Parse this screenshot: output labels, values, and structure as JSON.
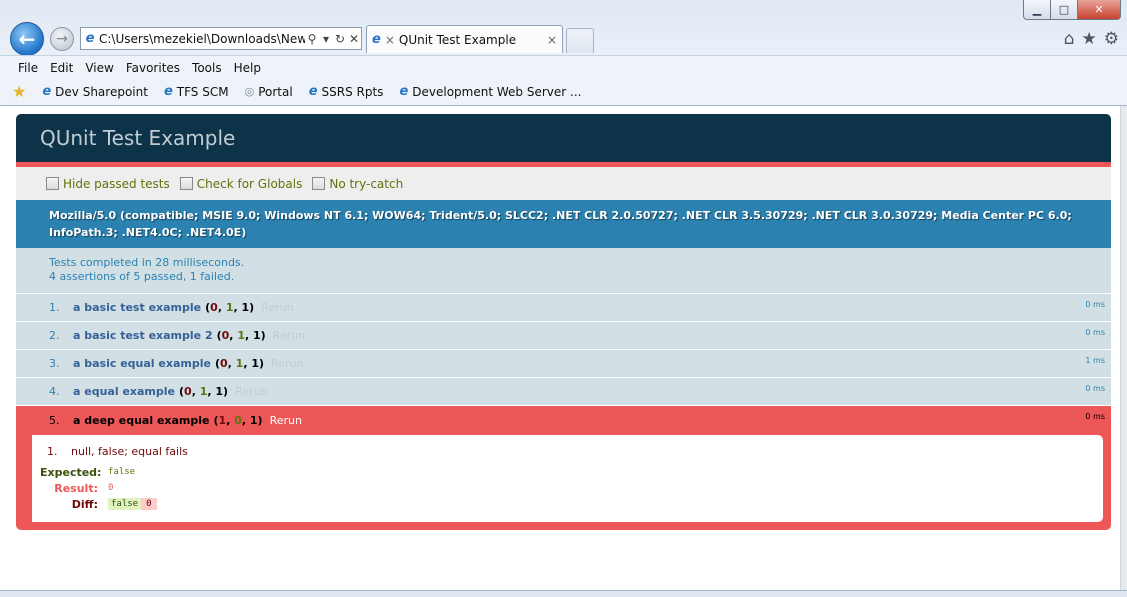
{
  "browser": {
    "address": "C:\\Users\\mezekiel\\Downloads\\New",
    "tab_title": "QUnit Test Example",
    "tab_close": "×",
    "menu": [
      "File",
      "Edit",
      "View",
      "Favorites",
      "Tools",
      "Help"
    ],
    "favorites": [
      "Dev Sharepoint",
      "TFS SCM",
      "Portal",
      "SSRS Rpts",
      "Development Web Server ..."
    ]
  },
  "qunit": {
    "title": "QUnit Test Example",
    "toolbar": {
      "hide_passed": "Hide passed tests",
      "check_globals": "Check for Globals",
      "no_try_catch": "No try-catch"
    },
    "user_agent": "Mozilla/5.0 (compatible; MSIE 9.0; Windows NT 6.1; WOW64; Trident/5.0; SLCC2; .NET CLR 2.0.50727; .NET CLR 3.5.30729; .NET CLR 3.0.30729; Media Center PC 6.0; InfoPath.3; .NET4.0C; .NET4.0E)",
    "result_line1": "Tests completed in 28 milliseconds.",
    "result_line2": "4 assertions of 5 passed, 1 failed.",
    "rerun_label": "Rerun",
    "tests": [
      {
        "num": "1.",
        "name": "a basic test example",
        "failed": "0",
        "passed": "1",
        "total": "1",
        "duration": "0 ms"
      },
      {
        "num": "2.",
        "name": "a basic test example 2",
        "failed": "0",
        "passed": "1",
        "total": "1",
        "duration": "0 ms"
      },
      {
        "num": "3.",
        "name": "a basic equal example",
        "failed": "0",
        "passed": "1",
        "total": "1",
        "duration": "1 ms"
      },
      {
        "num": "4.",
        "name": "a equal example",
        "failed": "0",
        "passed": "1",
        "total": "1",
        "duration": "0 ms"
      },
      {
        "num": "5.",
        "name": "a deep equal example",
        "failed": "1",
        "passed": "0",
        "total": "1",
        "duration": "0 ms"
      }
    ],
    "failed_assertion": {
      "num": "1.",
      "message": "null, false; equal fails",
      "expected_label": "Expected:",
      "expected_value": "false",
      "result_label": "Result:",
      "result_value": "0",
      "diff_label": "Diff:",
      "diff_del": "false",
      "diff_ins": "0"
    }
  }
}
